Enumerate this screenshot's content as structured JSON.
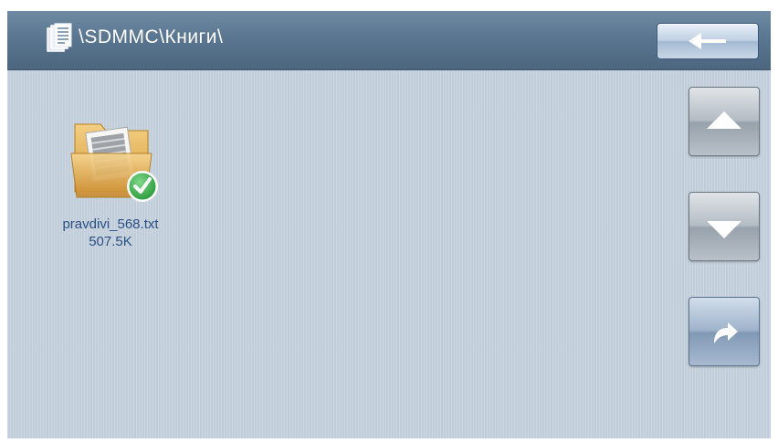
{
  "header": {
    "path": "\\SDMMC\\Книги\\",
    "path_icon": "document-stack-icon",
    "back_icon": "arrow-left-icon"
  },
  "sidebar": {
    "buttons": [
      {
        "name": "scroll-up",
        "icon": "triangle-up-icon"
      },
      {
        "name": "scroll-down",
        "icon": "triangle-down-icon"
      },
      {
        "name": "share",
        "icon": "curved-arrow-right-icon"
      }
    ]
  },
  "files": [
    {
      "name": "pravdivi_568.txt",
      "size": "507.5K",
      "icon": "folder-document-check-icon"
    }
  ],
  "colors": {
    "background": "#c6d3de",
    "title_bar": "#5b7690",
    "label_text": "#2a4f85",
    "check_badge": "#3aa94a"
  }
}
